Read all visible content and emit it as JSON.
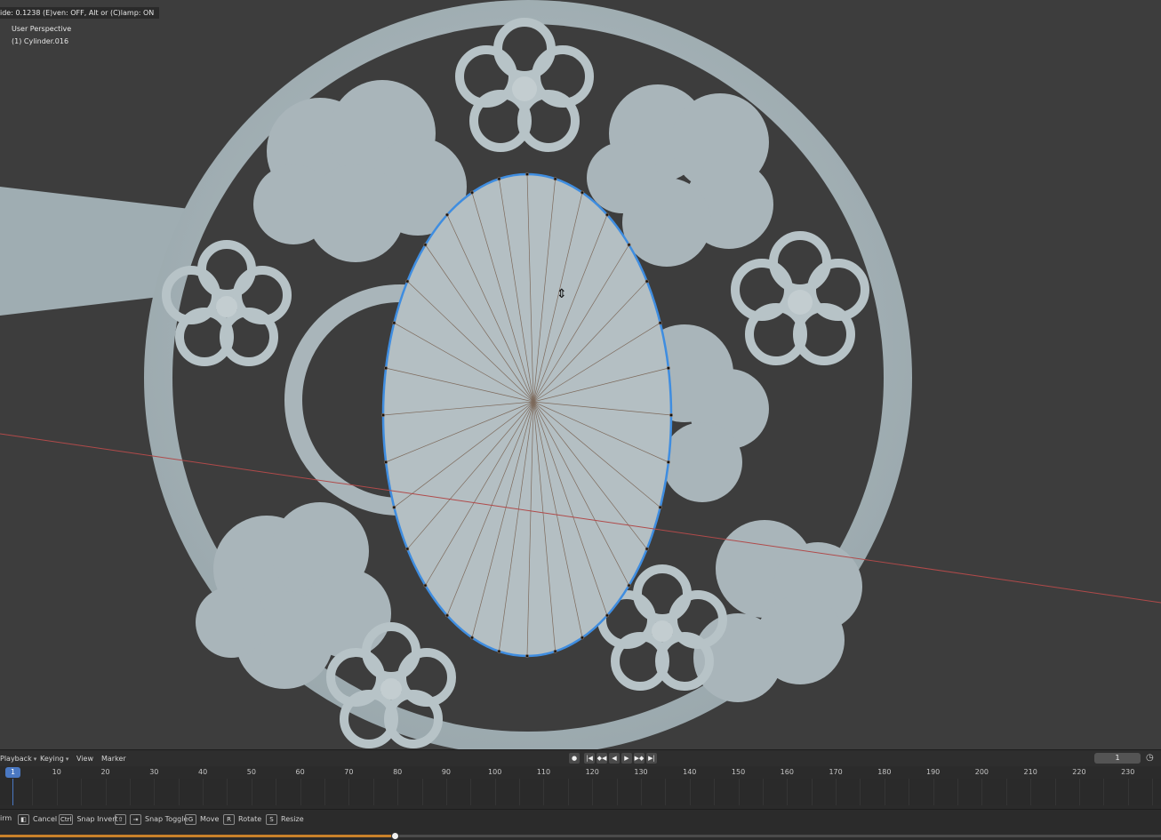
{
  "viewport": {
    "header_status": "ide: 0.1238 (E)ven: OFF, Alt or (C)lamp: ON",
    "view_name": "User Perspective",
    "object_name": "(1) Cylinder.016"
  },
  "timeline": {
    "menus": [
      "Playback",
      "Keying",
      "View",
      "Marker"
    ],
    "transport_icons": [
      "record-icon",
      "jump-start-icon",
      "prev-keyframe-icon",
      "play-reverse-icon",
      "play-icon",
      "next-keyframe-icon",
      "jump-end-icon"
    ],
    "current_frame_field": "1",
    "current_frame_marker": "1",
    "ruler_ticks": [
      "10",
      "20",
      "30",
      "40",
      "50",
      "60",
      "70",
      "80",
      "90",
      "100",
      "110",
      "120",
      "130",
      "140",
      "150",
      "160",
      "170",
      "180",
      "190",
      "200",
      "210",
      "220",
      "230"
    ]
  },
  "statusbar": {
    "hints": [
      {
        "key": "",
        "label": "irm"
      },
      {
        "key": "",
        "label": "Cancel"
      },
      {
        "key": "Ctrl",
        "label": "Snap Invert"
      },
      {
        "key": "⇧",
        "label": "Snap Toggle"
      },
      {
        "key": "G",
        "label": "Move"
      },
      {
        "key": "R",
        "label": "Rotate"
      },
      {
        "key": "S",
        "label": "Resize"
      }
    ],
    "progress_fraction": 0.34
  },
  "colors": {
    "viewport_bg": "#3d3d3d",
    "model": "#a9b6bb",
    "selection": "#3f8de0",
    "x_axis": "#b04a4a",
    "playhead": "#4a78c2"
  }
}
